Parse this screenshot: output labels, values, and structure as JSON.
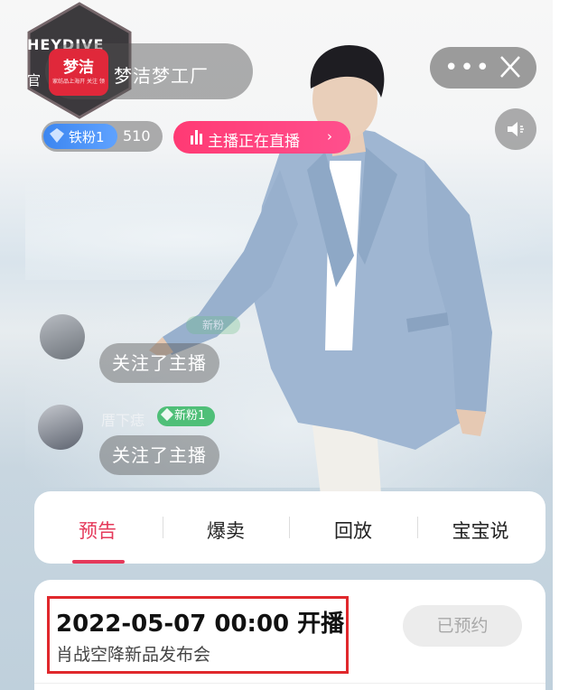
{
  "header": {
    "hex_badge_text": "HEYDIVE",
    "hex_badge_sub": "官",
    "store_logo_text": "梦洁",
    "store_logo_sub": "家纺品上海开 关注 领",
    "store_name": "梦洁梦工厂",
    "more_label": "•••"
  },
  "fans": {
    "badge_label": "铁粉1",
    "count": "510"
  },
  "live": {
    "label": "主播正在直播",
    "chevron": "›"
  },
  "chat": [
    {
      "name": "TATA爱洁",
      "tag": "新粉",
      "message": "关注了主播"
    },
    {
      "name": "厝下痣",
      "tag": "新粉1",
      "message": "关注了主播"
    }
  ],
  "tabs": [
    {
      "label": "预告",
      "active": true
    },
    {
      "label": "爆卖",
      "active": false
    },
    {
      "label": "回放",
      "active": false
    },
    {
      "label": "宝宝说",
      "active": false
    }
  ],
  "schedule": {
    "time": "2022-05-07 00:00 开播",
    "title": "肖战空降新品发布会",
    "button_label": "已预约"
  },
  "colors": {
    "accent": "#e5395a",
    "live_pink": "#ff3a74",
    "fans_blue": "#3c86f0",
    "highlight_red": "#e0282c"
  }
}
